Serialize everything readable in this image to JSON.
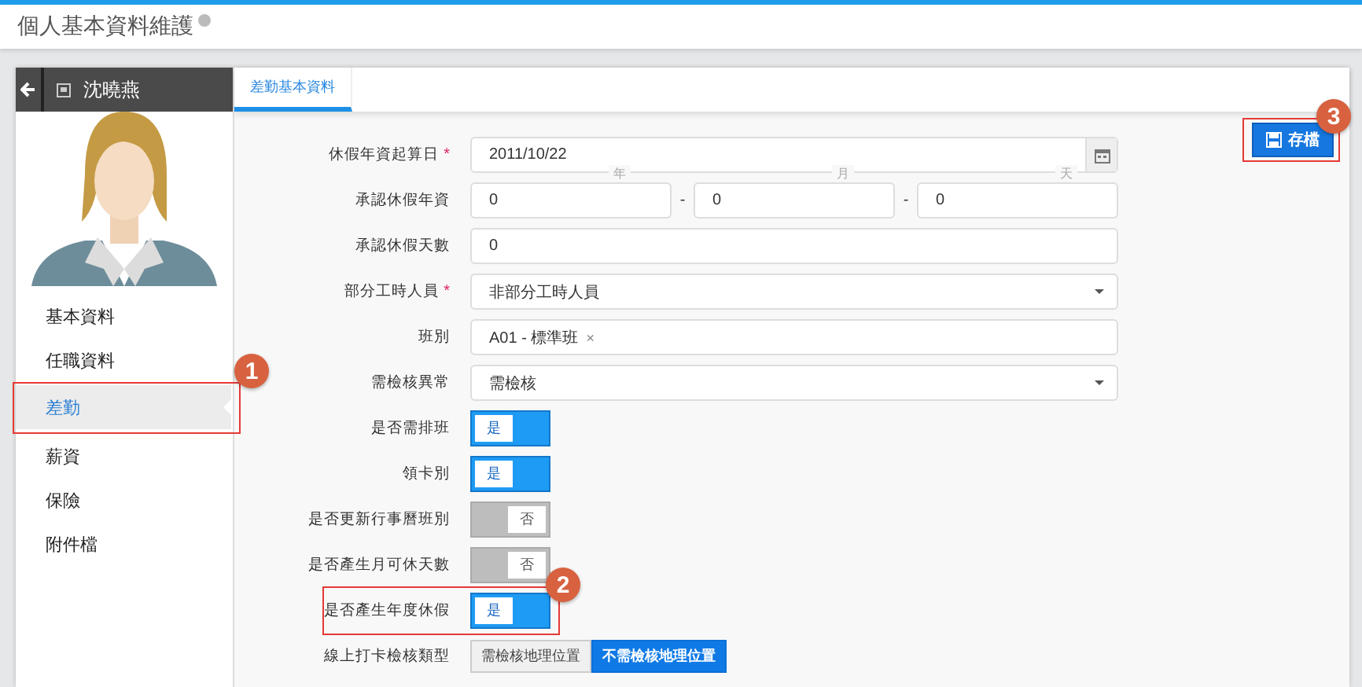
{
  "page": {
    "title": "個人基本資料維護"
  },
  "profile": {
    "name": "沈曉燕"
  },
  "sidebar": {
    "items": [
      {
        "label": "基本資料",
        "selected": false
      },
      {
        "label": "任職資料",
        "selected": false
      },
      {
        "label": "差勤",
        "selected": true,
        "callout": "1"
      },
      {
        "label": "薪資",
        "selected": false
      },
      {
        "label": "保險",
        "selected": false
      },
      {
        "label": "附件檔",
        "selected": false
      }
    ]
  },
  "tabs": [
    {
      "label": "差勤基本資料",
      "selected": true
    }
  ],
  "save_button": {
    "label": "存檔",
    "callout": "3"
  },
  "form": {
    "rows": [
      {
        "kind": "date",
        "label": "休假年資起算日",
        "required_mark": "*",
        "value": "2011/10/22"
      },
      {
        "kind": "triple",
        "label": "承認休假年資",
        "parts": [
          {
            "caption": "年",
            "value": "0"
          },
          {
            "caption": "月",
            "value": "0"
          },
          {
            "caption": "天",
            "value": "0"
          }
        ],
        "separator": "-"
      },
      {
        "kind": "text",
        "label": "承認休假天數",
        "value": "0"
      },
      {
        "kind": "select",
        "label": "部分工時人員",
        "required_mark": "*",
        "value": "非部分工時人員"
      },
      {
        "kind": "tags",
        "label": "班別",
        "tags": [
          {
            "label": "A01 - 標準班",
            "remove": "×"
          }
        ]
      },
      {
        "kind": "select",
        "label": "需檢核異常",
        "value": "需檢核"
      },
      {
        "kind": "toggle",
        "label": "是否需排班",
        "on": true,
        "state_label": "是"
      },
      {
        "kind": "toggle",
        "label": "領卡別",
        "on": true,
        "state_label": "是"
      },
      {
        "kind": "toggle",
        "label": "是否更新行事曆班別",
        "on": false,
        "state_label": "否"
      },
      {
        "kind": "toggle",
        "label": "是否產生月可休天數",
        "on": false,
        "state_label": "否"
      },
      {
        "kind": "toggle",
        "label": "是否產生年度休假",
        "on": true,
        "state_label": "是",
        "callout": "2"
      },
      {
        "kind": "segmented",
        "label": "線上打卡檢核類型",
        "options": [
          {
            "label": "需檢核地理位置",
            "selected": false
          },
          {
            "label": "不需檢核地理位置",
            "selected": true
          }
        ]
      }
    ]
  }
}
